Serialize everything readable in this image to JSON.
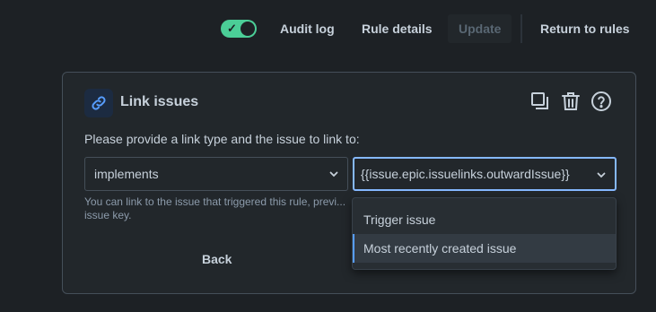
{
  "topbar": {
    "toggle_state": "on",
    "audit_log": "Audit log",
    "rule_details": "Rule details",
    "update": "Update",
    "return_to_rules": "Return to rules"
  },
  "card": {
    "title": "Link issues",
    "prompt": "Please provide a link type and the issue to link to:",
    "link_type": {
      "value": "implements"
    },
    "issue": {
      "value": "{{issue.epic.issuelinks.outwardIssue}}"
    },
    "help_text": "You can link to the issue that triggered this rule, previ... issue key.",
    "back": "Back",
    "icons": [
      "link-icon",
      "copy-icon",
      "trash-icon",
      "help-icon"
    ]
  },
  "dropdown": {
    "options": [
      "Trigger issue",
      "Most recently created issue"
    ],
    "highlighted_index": 1
  },
  "colors": {
    "toggle_on": "#4bce97",
    "focus_border": "#85b8ff",
    "accent": "#579dff",
    "background": "#1d2125"
  }
}
